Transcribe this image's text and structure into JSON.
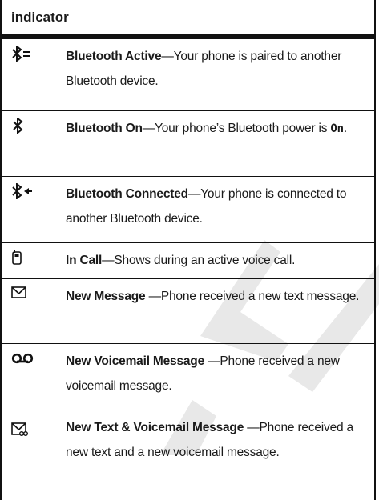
{
  "header": {
    "title": "indicator"
  },
  "rows": [
    {
      "icon": "bluetooth-active-icon",
      "title": "Bluetooth Active",
      "desc": "—Your phone is paired to another Bluetooth device."
    },
    {
      "icon": "bluetooth-on-icon",
      "title": "Bluetooth On",
      "desc": "—Your phone’s Bluetooth power is ",
      "desc_code": "On",
      "desc_end": "."
    },
    {
      "icon": "bluetooth-connected-icon",
      "title": "Bluetooth Connected",
      "desc": "—Your phone is connected to another Bluetooth device."
    },
    {
      "icon": "in-call-icon",
      "title": "In Call",
      "desc": "—Shows during an active voice call."
    },
    {
      "icon": "new-message-icon",
      "title": "New Message ",
      "desc": "—Phone received a new text message."
    },
    {
      "icon": "voicemail-icon",
      "title": "New Voicemail Message ",
      "desc": "—Phone received a new voicemail message."
    },
    {
      "icon": "text-voicemail-icon",
      "title": "New Text & Voicemail Message ",
      "desc": "—Phone received a new text and a new voicemail message."
    }
  ],
  "watermark": {
    "text": "DRAFT",
    "color": "#e6e6e6"
  }
}
